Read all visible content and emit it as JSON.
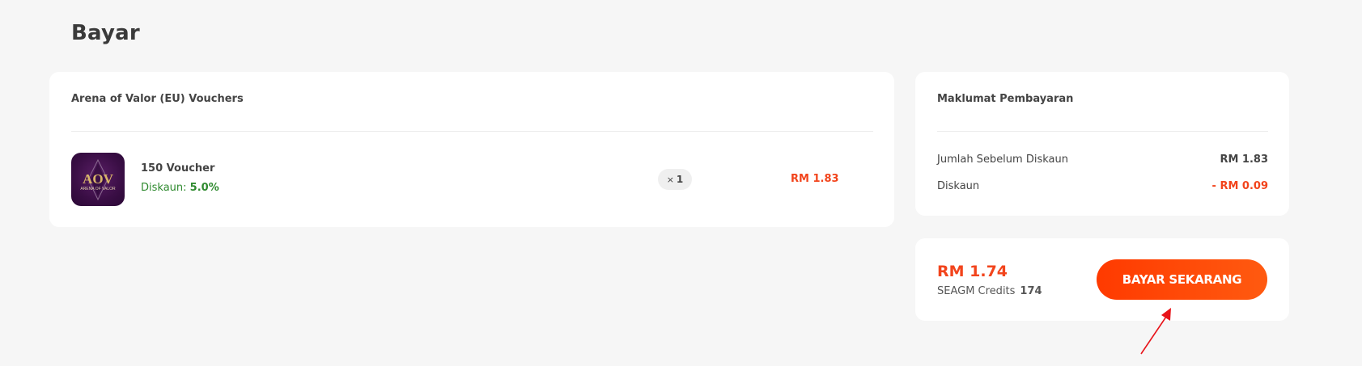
{
  "page": {
    "title": "Bayar"
  },
  "order": {
    "heading": "Arena of Valor (EU) Vouchers",
    "item": {
      "logo_icon": "aov-game-logo-icon",
      "logo_text": "AOV",
      "logo_subtext": "ARENA OF VALOR",
      "name": "150 Voucher",
      "discount_label": "Diskaun:",
      "discount_value": "5.0%",
      "qty_symbol": "×",
      "qty": "1",
      "price": "RM 1.83"
    }
  },
  "payment_info": {
    "heading": "Maklumat Pembayaran",
    "subtotal_label": "Jumlah Sebelum Diskaun",
    "subtotal_value": "RM 1.83",
    "discount_label": "Diskaun",
    "discount_value": "- RM 0.09"
  },
  "checkout": {
    "total": "RM 1.74",
    "credits_label": "SEAGM Credits",
    "credits_value": "174",
    "pay_button_label": "BAYAR SEKARANG"
  },
  "colors": {
    "accent": "#f2441c",
    "discount_green": "#2f8a2f",
    "background": "#f6f6f6",
    "annotation": "#e8141a"
  }
}
